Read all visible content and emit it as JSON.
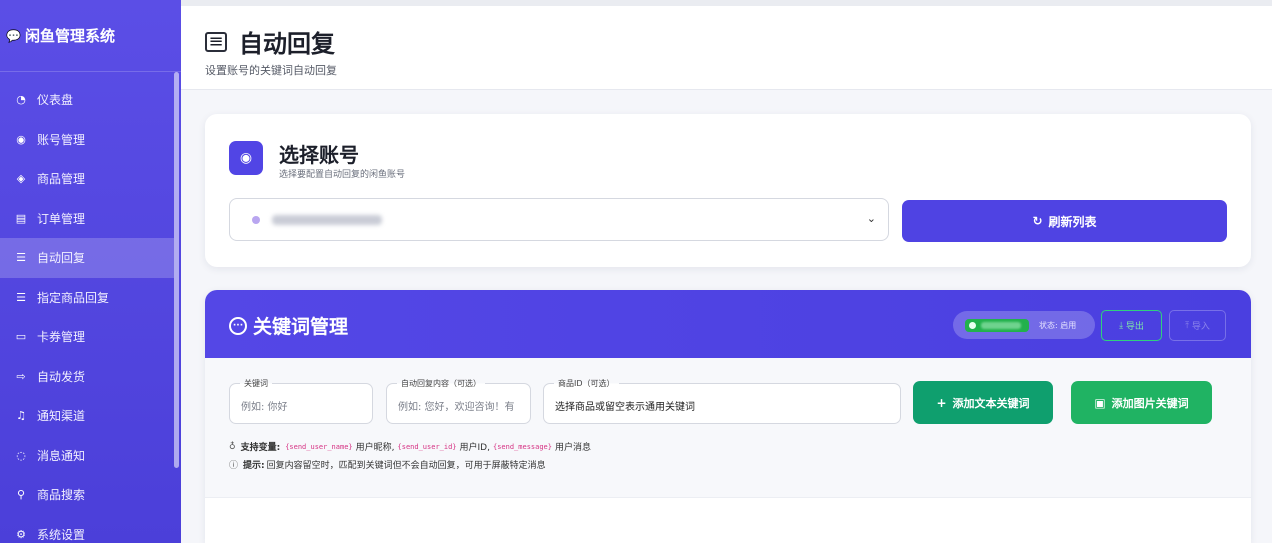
{
  "app": {
    "brand": "闲鱼管理系统",
    "brand_icon": "chat-bubble-icon"
  },
  "sidebar": {
    "items": [
      {
        "label": "仪表盘",
        "icon": "dashboard-icon",
        "glyph": "◔"
      },
      {
        "label": "账号管理",
        "icon": "user-circle-icon",
        "glyph": "◉"
      },
      {
        "label": "商品管理",
        "icon": "box-icon",
        "glyph": "◈"
      },
      {
        "label": "订单管理",
        "icon": "receipt-icon",
        "glyph": "▤"
      },
      {
        "label": "自动回复",
        "icon": "chat-square-icon",
        "glyph": "☰",
        "active": true
      },
      {
        "label": "指定商品回复",
        "icon": "chat-square-icon",
        "glyph": "☰"
      },
      {
        "label": "卡券管理",
        "icon": "card-icon",
        "glyph": "▭"
      },
      {
        "label": "自动发货",
        "icon": "truck-icon",
        "glyph": "⇨"
      },
      {
        "label": "通知渠道",
        "icon": "bell-icon",
        "glyph": "♫"
      },
      {
        "label": "消息通知",
        "icon": "chat-dots-icon",
        "glyph": "◌"
      },
      {
        "label": "商品搜索",
        "icon": "search-icon",
        "glyph": "⚲"
      },
      {
        "label": "系统设置",
        "icon": "gear-icon",
        "glyph": "⚙"
      }
    ]
  },
  "header": {
    "title": "自动回复",
    "subtitle": "设置账号的关键词自动回复"
  },
  "account_card": {
    "title": "选择账号",
    "subtitle": "选择要配置自动回复的闲鱼账号",
    "refresh_label": "刷新列表"
  },
  "keyword_card": {
    "title": "关键词管理",
    "status_text": "状态: 启用",
    "export_label": "导出",
    "import_label": "导入",
    "fields": {
      "keyword": {
        "label": "关键词",
        "placeholder": "例如: 你好"
      },
      "reply": {
        "label": "自动回复内容（可选）",
        "placeholder": "例如: 您好，欢迎咨询！有"
      },
      "item_id": {
        "label": "商品ID（可选）",
        "value": "选择商品或留空表示通用关键词"
      }
    },
    "add_text_label": "添加文本关键词",
    "add_image_label": "添加图片关键词",
    "vars_title": "支持变量:",
    "var_user_name": "{send_user_name}",
    "var_user_name_desc": "用户昵称,",
    "var_user_id": "{send_user_id}",
    "var_user_id_desc": "用户ID,",
    "var_message": "{send_message}",
    "var_message_desc": "用户消息",
    "tip_title": "提示:",
    "tip_text": "回复内容留空时，匹配到关键词但不会自动回复，可用于屏蔽特定消息"
  },
  "colors": {
    "accent": "#4f43e3",
    "success": "#0f9f6e",
    "success_alt": "#20b363"
  }
}
